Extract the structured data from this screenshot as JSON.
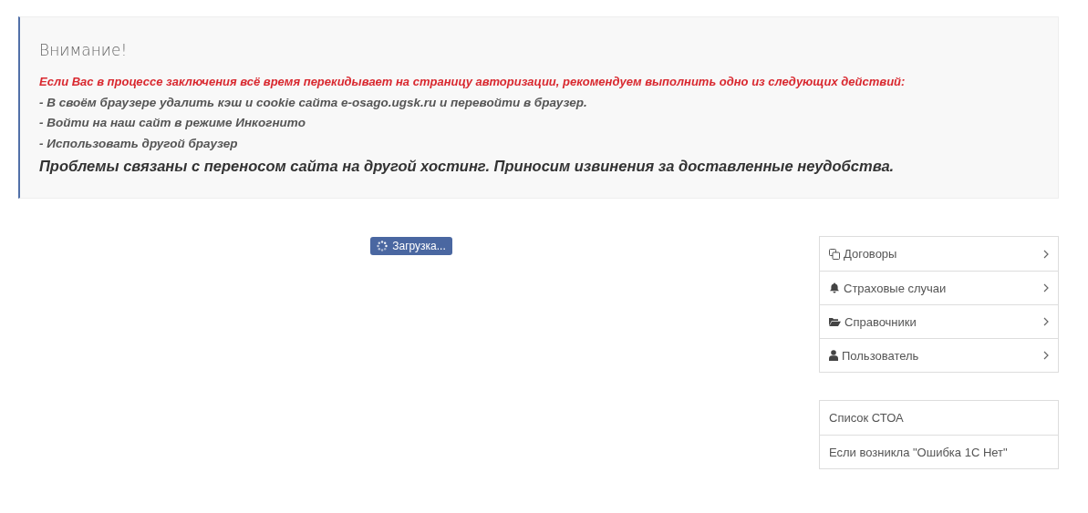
{
  "alert": {
    "title": "Внимание!",
    "lines": [
      {
        "kind": "warning",
        "text": "Если Вас в процессе заключения всё время перекидывает на страницу авторизации, рекомендуем выполнить одно из следующих действий:"
      },
      {
        "kind": "step",
        "text": "- В своём браузере удалить кэш и cookie сайта e-osago.ugsk.ru и перевойти в браузер."
      },
      {
        "kind": "step",
        "text": "- Войти на наш сайт в режиме Инкогнито"
      },
      {
        "kind": "step",
        "text": "- Использовать другой браузер"
      },
      {
        "kind": "headline",
        "text": "Проблемы связаны с переносом сайта на другой хостинг. Приносим извинения за доставленные неудобства."
      }
    ]
  },
  "loading": {
    "label": "Загрузка..."
  },
  "menu": [
    {
      "label": "Договоры"
    },
    {
      "label": "Страховые случаи"
    },
    {
      "label": "Справочники"
    },
    {
      "label": "Пользователь"
    }
  ],
  "links": [
    {
      "label": "Список СТОА"
    },
    {
      "label": "Если возникла \"Ошибка 1С Нет\""
    }
  ]
}
